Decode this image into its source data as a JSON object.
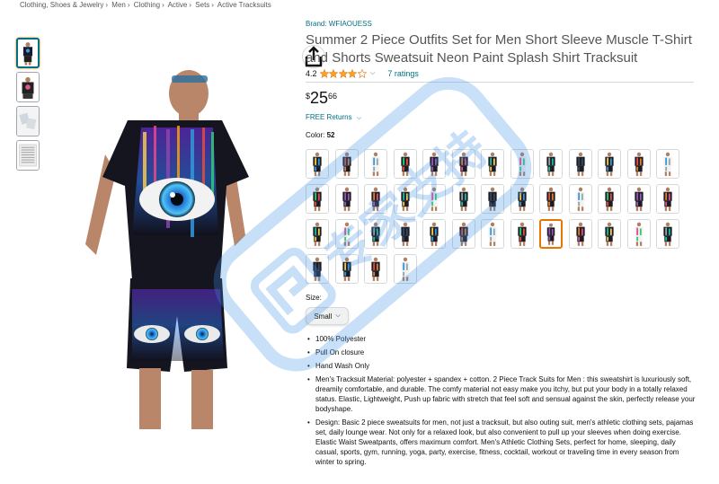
{
  "breadcrumb": [
    "Clothing, Shoes & Jewelry",
    "Men",
    "Clothing",
    "Active",
    "Sets",
    "Active Tracksuits"
  ],
  "product": {
    "brand": "Brand: WFIAOUESS",
    "title": "Summer 2 Piece Outfits Set for Men Short Sleeve Muscle T-Shirt and Shorts Sweatsuit Neon Paint Splash Shirt Tracksuit",
    "rating": "4.2",
    "rating_value": 4.2,
    "ratings_count": "7 ratings",
    "price": {
      "currency": "$",
      "dollars": "25",
      "cents": "66"
    },
    "returns": "FREE Returns",
    "color_label": "Color:",
    "color_value": "52",
    "swatch_count": 43,
    "selected_swatch": 34,
    "size_label": "Size:",
    "size_value": "Small"
  },
  "bullets": [
    "100% Polyester",
    "Pull On closure",
    "Hand Wash Only",
    "Men's Tracksuit Material: polyester + spandex + cotton. 2 Piece Track Suits for Men : this sweatshirt is luxuriously soft, dreamily comfortable, and durable. The comfy material not easy make you itchy, but put your body in a totally relaxed status. Elastic, Lightweight, Push up fabric with stretch that feel soft and sensual against the skin, perfectly release your bodyshape.",
    "Design: Basic 2 piece sweatsuits for men, not just a tracksuit, but also outing suit, men's athletic clothing sets, pajamas set, daily lounge wear. Not only for a relaxed look, but also convenient to pull up your sleeves when doing exercise. Elastic Waist Sweatpants, offers maximum comfort. Men's Athletic Clothing Sets, perfect for home, sleeping, daily casual, sports, gym, running, yoga, party, exercise, fitness, cocktail, workout or traveling time in every season from winter to spring."
  ],
  "watermark_text": "专家支持",
  "colors": {
    "link": "#007185",
    "star": "#ffa41c",
    "selected": "#e77600",
    "watermark": "#3d8ee8"
  }
}
